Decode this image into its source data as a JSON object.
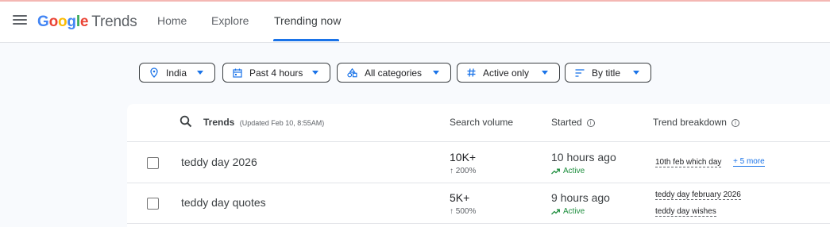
{
  "app": {
    "logo_google": "Google",
    "logo_trends": "Trends",
    "brand_colors": [
      "#4285F4",
      "#EA4335",
      "#FBBC05",
      "#4285F4",
      "#34A853",
      "#EA4335"
    ]
  },
  "nav": {
    "home": "Home",
    "explore": "Explore",
    "trending_now": "Trending now"
  },
  "filters": {
    "location": "India",
    "time": "Past 4 hours",
    "category": "All categories",
    "status": "Active only",
    "sort": "By title"
  },
  "table": {
    "header_trends": "Trends",
    "header_updated": "(Updated Feb 10, 8:55AM)",
    "header_volume": "Search volume",
    "header_started": "Started",
    "header_breakdown": "Trend breakdown",
    "rows": [
      {
        "title": "teddy day 2026",
        "volume": "10K+",
        "change": "↑ 200%",
        "started": "10 hours ago",
        "status": "Active",
        "breakdown": [
          "10th feb which day"
        ],
        "more": "+ 5 more"
      },
      {
        "title": "teddy day quotes",
        "volume": "5K+",
        "change": "↑ 500%",
        "started": "9 hours ago",
        "status": "Active",
        "breakdown": [
          "teddy day february 2026",
          "teddy day wishes"
        ]
      }
    ]
  },
  "icons": {
    "menu": "menu-icon",
    "location": "location-pin-icon",
    "calendar": "calendar-icon",
    "categories": "categories-icon",
    "hash": "hash-icon",
    "sort": "sort-icon",
    "search": "search-icon",
    "info": "info-icon",
    "trending": "trending-up-icon"
  },
  "colors": {
    "accent": "#1a73e8",
    "active_green": "#1e8e3e"
  }
}
